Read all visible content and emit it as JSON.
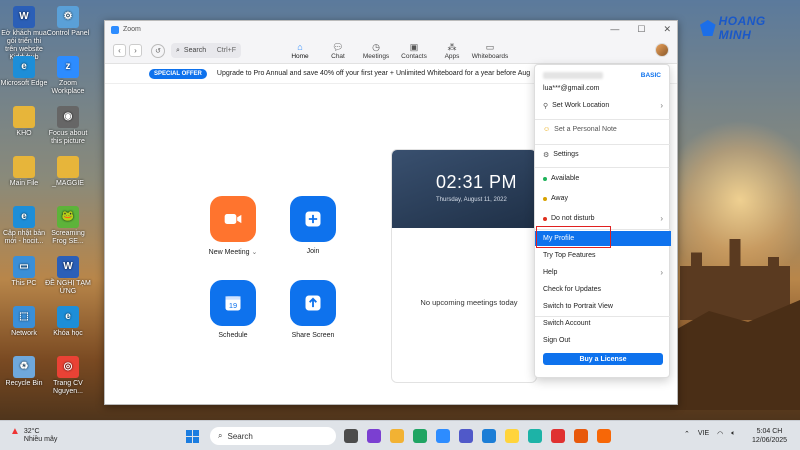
{
  "desktop": {
    "brand_logo": "HOANG MINH",
    "icons": [
      {
        "label": "Eờ khách mua gói triển thi trên website Kiddyhub",
        "color": "#2b5fb7",
        "glyph": "W"
      },
      {
        "label": "Control Panel",
        "color": "#5aa0d8",
        "glyph": "⚙"
      },
      {
        "label": "Microsoft Edge",
        "color": "#1d8ed8",
        "glyph": "e"
      },
      {
        "label": "Zoom Workplace",
        "color": "#2d8cff",
        "glyph": "z"
      },
      {
        "label": "KHO",
        "color": "#e7b53a",
        "glyph": ""
      },
      {
        "label": "Focus about this picture",
        "color": "#666666",
        "glyph": "◉"
      },
      {
        "label": "Main File",
        "color": "#e7b53a",
        "glyph": ""
      },
      {
        "label": "_MAGGIE",
        "color": "#e7b53a",
        "glyph": ""
      },
      {
        "label": "Cập nhật bản mới - hocit...",
        "color": "#1d8ed8",
        "glyph": "e"
      },
      {
        "label": "Screaming Frog SE...",
        "color": "#5db33a",
        "glyph": "🐸"
      },
      {
        "label": "This PC",
        "color": "#3a8fd8",
        "glyph": "▭"
      },
      {
        "label": "ĐỀ NGHỊ TẠM ỨNG",
        "color": "#2b5fb7",
        "glyph": "W"
      },
      {
        "label": "Network",
        "color": "#3a8fd8",
        "glyph": "⬚"
      },
      {
        "label": "Khóa học",
        "color": "#1d8ed8",
        "glyph": "e"
      },
      {
        "label": "Recycle Bin",
        "color": "#6fa8dc",
        "glyph": "♻"
      },
      {
        "label": "Trang CV Nguyen...",
        "color": "#e94235",
        "glyph": "◎"
      }
    ]
  },
  "window": {
    "title": "Zoom",
    "search_label": "Search",
    "search_shortcut": "Ctrl+F",
    "tabs": [
      {
        "label": "Home",
        "icon": "home-icon"
      },
      {
        "label": "Chat",
        "icon": "chat-icon"
      },
      {
        "label": "Meetings",
        "icon": "clock-icon"
      },
      {
        "label": "Contacts",
        "icon": "contacts-icon"
      },
      {
        "label": "Apps",
        "icon": "apps-icon"
      },
      {
        "label": "Whiteboards",
        "icon": "whiteboard-icon"
      }
    ],
    "offer_badge": "SPECIAL OFFER",
    "offer_text": "Upgrade to Pro Annual and save 40% off your first year + Unlimited Whiteboard for a year before Aug"
  },
  "home_actions": [
    {
      "label": "New Meeting",
      "suffix": "⌄",
      "color": "orange"
    },
    {
      "label": "Join",
      "suffix": "",
      "color": "blue"
    },
    {
      "label": "Schedule",
      "suffix": "",
      "color": "blue"
    },
    {
      "label": "Share Screen",
      "suffix": "",
      "color": "blue"
    }
  ],
  "calendar": {
    "time": "02:31 PM",
    "date": "Thursday, August 11, 2022",
    "empty_text": "No upcoming meetings today"
  },
  "profile_menu": {
    "plan": "BASIC",
    "email": "lua***@gmail.com",
    "items": {
      "location": "Set Work Location",
      "note": "Set a Personal Note",
      "settings": "Settings",
      "available": "Available",
      "away": "Away",
      "dnd": "Do not disturb",
      "profile": "My Profile",
      "features": "Try Top Features",
      "help": "Help",
      "updates": "Check for Updates",
      "portrait": "Switch to Portrait View",
      "switch_account": "Switch Account",
      "sign_out": "Sign Out"
    },
    "license_button": "Buy a License"
  },
  "taskbar": {
    "temperature": "32°C",
    "weather": "Nhiều mây",
    "search": "Search",
    "lang": "VIE",
    "time": "5:04 CH",
    "date": "12/06/2025"
  }
}
